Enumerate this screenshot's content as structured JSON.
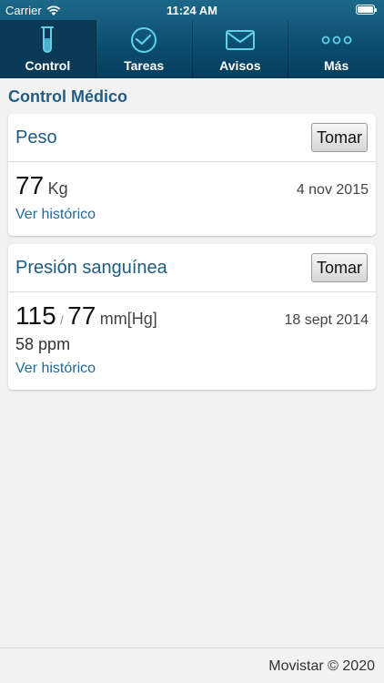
{
  "status_bar": {
    "carrier": "Carrier",
    "time": "11:24 AM"
  },
  "tabs": [
    {
      "label": "Control",
      "icon": "test-tube-icon",
      "active": true
    },
    {
      "label": "Tareas",
      "icon": "clock-icon",
      "active": false
    },
    {
      "label": "Avisos",
      "icon": "envelope-icon",
      "active": false
    },
    {
      "label": "Más",
      "icon": "more-dots-icon",
      "active": false
    }
  ],
  "section_title": "Control Médico",
  "weight_card": {
    "title": "Peso",
    "button": "Tomar",
    "value": "77",
    "unit": "Kg",
    "date": "4 nov 2015",
    "history": "Ver histórico"
  },
  "pressure_card": {
    "title": "Presión sanguínea",
    "button": "Tomar",
    "systolic": "115",
    "separator": "/",
    "diastolic": "77",
    "unit": "mm[Hg]",
    "date": "18 sept 2014",
    "pulse": "58",
    "pulse_unit": "ppm",
    "history": "Ver histórico"
  },
  "footer": {
    "text": "Movistar © 2020"
  },
  "colors": {
    "header": "#0b4d6f",
    "accent": "#1f5f86",
    "link": "#1f6a9a",
    "icon": "#5fd0e8"
  }
}
